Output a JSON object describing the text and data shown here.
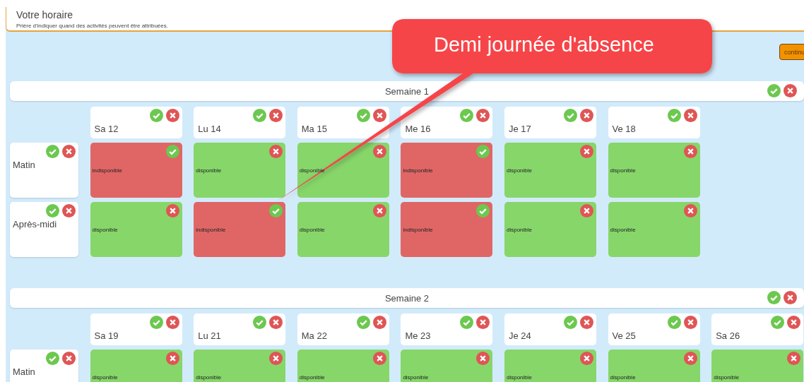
{
  "header": {
    "title": "Votre horaire",
    "subtitle": "Prière d'indiquer quand des activités peuvent être attribuées."
  },
  "continue_button": "continu",
  "callout": {
    "text": "Demi journée d'absence"
  },
  "weeks": [
    {
      "title": "Semaine 1",
      "days": [
        {
          "label": "Sa 12"
        },
        {
          "label": "Lu 14"
        },
        {
          "label": "Ma 15"
        },
        {
          "label": "Me 16"
        },
        {
          "label": "Je 17"
        },
        {
          "label": "Ve 18"
        }
      ],
      "periods": [
        {
          "label": "Matin",
          "slots": [
            {
              "text": "indisponible",
              "available": false
            },
            {
              "text": "disponible",
              "available": true
            },
            {
              "text": "disponible",
              "available": true
            },
            {
              "text": "indisponible",
              "available": false
            },
            {
              "text": "disponible",
              "available": true
            },
            {
              "text": "disponible",
              "available": true
            }
          ]
        },
        {
          "label": "Après-midi",
          "slots": [
            {
              "text": "disponible",
              "available": true
            },
            {
              "text": "indisponible",
              "available": false
            },
            {
              "text": "disponible",
              "available": true
            },
            {
              "text": "indisponible",
              "available": false
            },
            {
              "text": "disponible",
              "available": true
            },
            {
              "text": "disponible",
              "available": true
            }
          ]
        }
      ]
    },
    {
      "title": "Semaine 2",
      "days": [
        {
          "label": "Sa 19"
        },
        {
          "label": "Lu 21"
        },
        {
          "label": "Ma 22"
        },
        {
          "label": "Me 23"
        },
        {
          "label": "Je 24"
        },
        {
          "label": "Ve 25"
        },
        {
          "label": "Sa 26"
        }
      ],
      "periods": [
        {
          "label": "Matin",
          "slots": [
            {
              "text": "disponible",
              "available": true
            },
            {
              "text": "disponible",
              "available": true
            },
            {
              "text": "disponible",
              "available": true
            },
            {
              "text": "disponible",
              "available": true
            },
            {
              "text": "disponible",
              "available": true
            },
            {
              "text": "disponible",
              "available": true
            },
            {
              "text": "disponible",
              "available": true
            }
          ]
        }
      ]
    }
  ]
}
